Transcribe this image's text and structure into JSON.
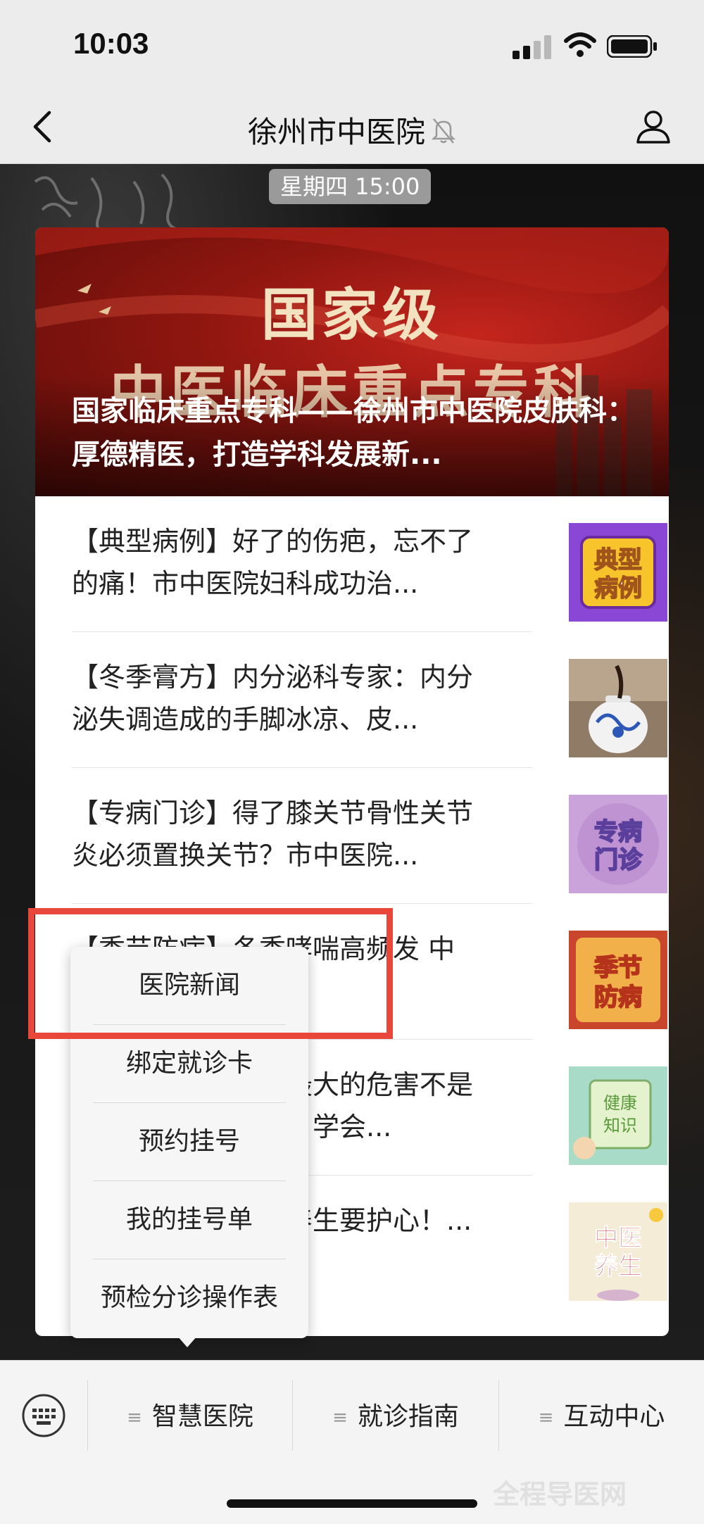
{
  "status_bar": {
    "time": "10:03"
  },
  "nav": {
    "title": "徐州市中医院"
  },
  "chat": {
    "timestamp": "星期四 15:00",
    "banner": {
      "heading_line1": "国家级",
      "heading_line2": "中医临床重点专科",
      "caption": "国家临床重点专科——徐州市中医院皮肤科：厚德精医，打造学科发展新..."
    },
    "articles": [
      {
        "title": "【典型病例】好了的伤疤，忘不了的痛！市中医院妇科成功治...",
        "thumb_text": "典型病例"
      },
      {
        "title": "【冬季膏方】内分泌科专家：内分泌失调造成的手脚冰凉、皮...",
        "thumb_text": ""
      },
      {
        "title": "【专病门诊】得了膝关节骨性关节炎必须置换关节？市中医院...",
        "thumb_text": "专病门诊"
      },
      {
        "title": "【季节防病】冬季哮喘高频发 中医...",
        "thumb_text": "季节防病"
      },
      {
        "title": "【健康知识】冬季最大的危害不是寒冷，是煤气中毒！学会...",
        "thumb_text": "健康知识"
      },
      {
        "title": "【中医养生】冬季养生要护心！...预防疾病...",
        "thumb_text": "中医养生"
      }
    ]
  },
  "popup_menu": {
    "items": [
      "医院新闻",
      "绑定就诊卡",
      "预约挂号",
      "我的挂号单",
      "预检分诊操作表"
    ]
  },
  "bottom_menu": {
    "tabs": [
      "智慧医院",
      "就诊指南",
      "互动中心"
    ]
  },
  "watermark": "全程导医网",
  "colors": {
    "highlight": "#e8473a",
    "banner_red": "#8f1610"
  }
}
